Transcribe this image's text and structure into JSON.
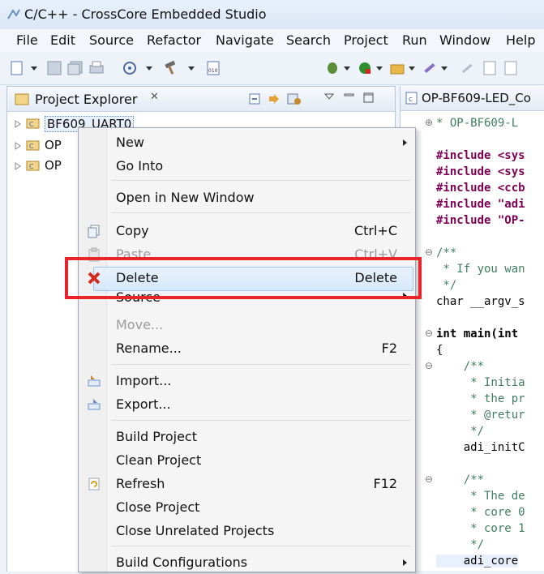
{
  "window": {
    "title": "C/C++ - CrossCore Embedded Studio"
  },
  "menubar": [
    "File",
    "Edit",
    "Source",
    "Refactor",
    "Navigate",
    "Search",
    "Project",
    "Run",
    "Window",
    "Help"
  ],
  "project_explorer": {
    "title": "Project Explorer",
    "close_glyph": "✕",
    "items": [
      "BF609_UART0",
      "OP",
      "OP"
    ]
  },
  "editor": {
    "tab_title": "OP-BF609-LED_Co",
    "lines": [
      "* OP-BF609-L",
      "",
      "#include <sys",
      "#include <sys",
      "#include <ccb",
      "#include \"adi",
      "#include \"OP-",
      "",
      "/**",
      " * If you wan",
      " */",
      "char __argv_s",
      "",
      "int main(int",
      "{",
      "    /**",
      "     * Initia",
      "     * the pr",
      "     * @retur",
      "     */",
      "    adi_initC",
      "",
      "    /**",
      "     * The de",
      "     * core 0",
      "     * core 1",
      "     */",
      "    adi_core"
    ]
  },
  "context_menu": {
    "items": [
      {
        "label": "New",
        "shortcut": "",
        "submenu": true,
        "disabled": false
      },
      {
        "label": "Go Into",
        "shortcut": "",
        "submenu": false,
        "disabled": false
      },
      {
        "label": "Open in New Window",
        "shortcut": "",
        "submenu": false,
        "disabled": false
      },
      {
        "label": "Copy",
        "shortcut": "Ctrl+C",
        "submenu": false,
        "disabled": false
      },
      {
        "label": "Paste",
        "shortcut": "Ctrl+V",
        "submenu": false,
        "disabled": true
      },
      {
        "label": "Delete",
        "shortcut": "Delete",
        "submenu": false,
        "disabled": false
      },
      {
        "label": "Source",
        "shortcut": "",
        "submenu": true,
        "disabled": false
      },
      {
        "label": "Move...",
        "shortcut": "",
        "submenu": false,
        "disabled": true
      },
      {
        "label": "Rename...",
        "shortcut": "F2",
        "submenu": false,
        "disabled": false
      },
      {
        "label": "Import...",
        "shortcut": "",
        "submenu": false,
        "disabled": false
      },
      {
        "label": "Export...",
        "shortcut": "",
        "submenu": false,
        "disabled": false
      },
      {
        "label": "Build Project",
        "shortcut": "",
        "submenu": false,
        "disabled": false
      },
      {
        "label": "Clean Project",
        "shortcut": "",
        "submenu": false,
        "disabled": false
      },
      {
        "label": "Refresh",
        "shortcut": "F12",
        "submenu": false,
        "disabled": false
      },
      {
        "label": "Close Project",
        "shortcut": "",
        "submenu": false,
        "disabled": false
      },
      {
        "label": "Close Unrelated Projects",
        "shortcut": "",
        "submenu": false,
        "disabled": false
      },
      {
        "label": "Build Configurations",
        "shortcut": "",
        "submenu": true,
        "disabled": false
      }
    ]
  },
  "colors": {
    "highlight_box": "#e8242a",
    "delete_icon": "#d42a1f"
  }
}
